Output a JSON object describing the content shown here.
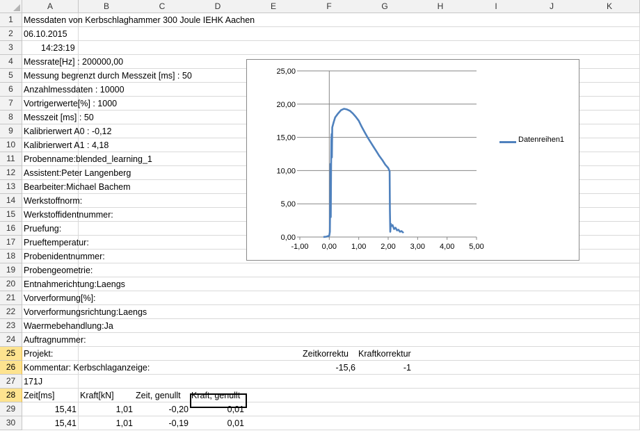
{
  "columns": [
    "A",
    "B",
    "C",
    "D",
    "E",
    "F",
    "G",
    "H",
    "I",
    "J",
    "K"
  ],
  "rows": [
    "1",
    "2",
    "3",
    "4",
    "5",
    "6",
    "7",
    "8",
    "9",
    "10",
    "11",
    "12",
    "13",
    "14",
    "15",
    "16",
    "17",
    "18",
    "19",
    "20",
    "21",
    "22",
    "23",
    "24",
    "25",
    "26",
    "27",
    "28",
    "29",
    "30"
  ],
  "selected_rows": [
    "25",
    "26",
    "28"
  ],
  "cells": {
    "r1": {
      "A": "Messdaten von Kerbschlaghammer 300 Joule IEHK Aachen"
    },
    "r2": {
      "A": "06.10.2015"
    },
    "r3": {
      "A": "14:23:19"
    },
    "r4": {
      "A": "Messrate[Hz] : 200000,00"
    },
    "r5": {
      "A": "Messung begrenzt durch Messzeit [ms] : 50"
    },
    "r6": {
      "A": "Anzahlmessdaten : 10000"
    },
    "r7": {
      "A": "Vortrigerwerte[%] : 1000"
    },
    "r8": {
      "A": "Messzeit [ms] : 50"
    },
    "r9": {
      "A": "Kalibrierwert A0 : -0,12"
    },
    "r10": {
      "A": "Kalibrierwert A1 : 4,18"
    },
    "r11": {
      "A": "Probenname:blended_learning_1"
    },
    "r12": {
      "A": "Assistent:Peter Langenberg"
    },
    "r13": {
      "A": "Bearbeiter:Michael Bachem"
    },
    "r14": {
      "A": "Werkstoffnorm:"
    },
    "r15": {
      "A": "Werkstoffidentnummer:"
    },
    "r16": {
      "A": "Pruefung:"
    },
    "r17": {
      "A": "Prueftemperatur:"
    },
    "r18": {
      "A": "Probenidentnummer:"
    },
    "r19": {
      "A": "Probengeometrie:"
    },
    "r20": {
      "A": "Entnahmerichtung:Laengs"
    },
    "r21": {
      "A": "Vorverformung[%]:"
    },
    "r22": {
      "A": "Vorverformungsrichtung:Laengs"
    },
    "r23": {
      "A": "Waermebehandlung:Ja"
    },
    "r24": {
      "A": "Auftragnummer:"
    },
    "r25": {
      "A": "Projekt:",
      "F": "Zeitkorrektu",
      "G": "Kraftkorrektur"
    },
    "r26": {
      "A": "Kommentar: Kerbschlaganzeige:",
      "F": "-15,6",
      "G": "-1"
    },
    "r27": {
      "A": "171J"
    },
    "r28": {
      "A": "Zeit[ms]",
      "B": "Kraft[kN]",
      "C": "Zeit, genullt",
      "D": "Kraft, genullt"
    },
    "r29": {
      "A": "15,41",
      "B": "1,01",
      "C": "-0,20",
      "D": "0,01"
    },
    "r30": {
      "A": "15,41",
      "B": "1,01",
      "C": "-0,19",
      "D": "0,01"
    }
  },
  "chart_data": {
    "type": "line",
    "series": [
      {
        "name": "Datenreihen1",
        "x": [
          -0.2,
          -0.1,
          0.0,
          0.02,
          0.03,
          0.04,
          0.05,
          0.06,
          0.07,
          0.08,
          0.09,
          0.1,
          0.12,
          0.15,
          0.2,
          0.3,
          0.4,
          0.5,
          0.6,
          0.7,
          0.8,
          0.9,
          1.0,
          1.1,
          1.2,
          1.3,
          1.4,
          1.5,
          1.6,
          1.7,
          1.8,
          1.9,
          2.0,
          2.05,
          2.06,
          2.07,
          2.09,
          2.1,
          2.15,
          2.2,
          2.25,
          2.3,
          2.35,
          2.4,
          2.45,
          2.5,
          2.52
        ],
        "y": [
          0.01,
          0.05,
          0.2,
          0.8,
          5.0,
          11.0,
          3.0,
          10.0,
          14.5,
          15.5,
          12.0,
          16.5,
          16.8,
          17.3,
          18.0,
          18.6,
          19.1,
          19.3,
          19.2,
          19.0,
          18.6,
          18.1,
          17.5,
          16.6,
          15.8,
          15.0,
          14.3,
          13.6,
          12.9,
          12.2,
          11.6,
          10.9,
          10.4,
          9.9,
          4.0,
          0.8,
          2.0,
          1.6,
          1.8,
          1.2,
          1.4,
          1.0,
          1.1,
          0.8,
          0.9,
          0.7,
          0.8
        ]
      }
    ],
    "xlim": [
      -1.0,
      5.0
    ],
    "ylim": [
      0.0,
      25.0
    ],
    "xticks": [
      "-1,00",
      "0,00",
      "1,00",
      "2,00",
      "3,00",
      "4,00",
      "5,00"
    ],
    "yticks": [
      "0,00",
      "5,00",
      "10,00",
      "15,00",
      "20,00",
      "25,00"
    ],
    "grid": "horizontal",
    "legend": "right",
    "color": "#4f81bd"
  }
}
